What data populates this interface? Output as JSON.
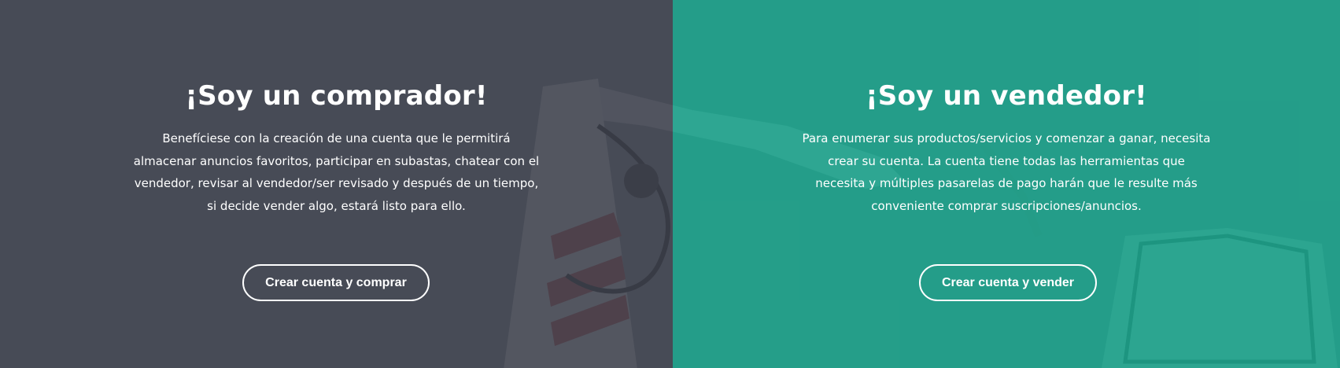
{
  "buyer": {
    "title": "¡Soy un comprador!",
    "description": "Benefíciese con la creación de una cuenta que le permitirá almacenar anuncios favoritos, participar en subastas, chatear con el vendedor, revisar al vendedor/ser revisado y después de un tiempo, si decide vender algo, estará listo para ello.",
    "button_label": "Crear cuenta y comprar"
  },
  "seller": {
    "title": "¡Soy un vendedor!",
    "description": "Para enumerar sus productos/servicios y comenzar a ganar, necesita crear su cuenta. La cuenta tiene todas las herramientas que necesita y múltiples pasarelas de pago harán que le resulte más conveniente comprar suscripciones/anuncios.",
    "button_label": "Crear cuenta y vender"
  },
  "colors": {
    "buyer_overlay": "#3c404c",
    "seller_overlay": "#14a087",
    "text": "#ffffff"
  },
  "background_image": "excavator-photo"
}
